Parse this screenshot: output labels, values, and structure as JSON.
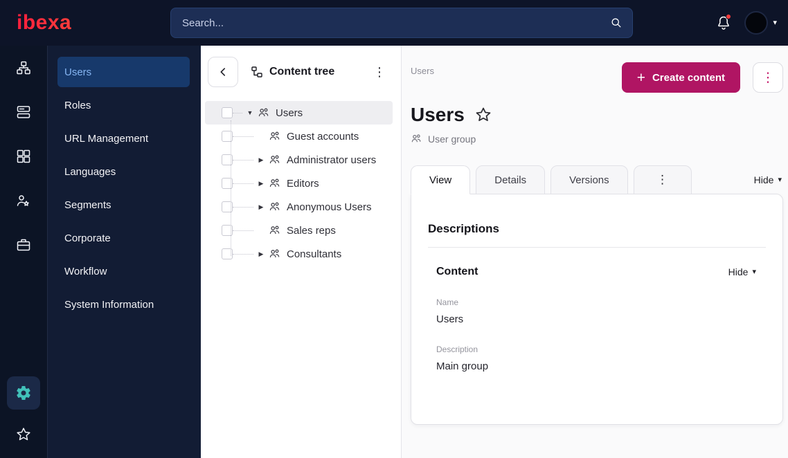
{
  "topbar": {
    "logo_text": "ibexa",
    "search_placeholder": "Search..."
  },
  "rail": {
    "items": [
      "sitemap-icon",
      "content-list-icon",
      "modules-icon",
      "personalization-icon",
      "corporate-icon"
    ],
    "bottom_items": [
      "settings-gear-icon",
      "star-icon"
    ],
    "active_item": "settings-gear-icon"
  },
  "sidebar": {
    "items": [
      "Users",
      "Roles",
      "URL Management",
      "Languages",
      "Segments",
      "Corporate",
      "Workflow",
      "System Information"
    ],
    "active_item": "Users"
  },
  "content_tree": {
    "title": "Content tree",
    "items": [
      {
        "label": "Users",
        "arrow": "▼",
        "level": 0,
        "selected": true
      },
      {
        "label": "Guest accounts",
        "arrow": "",
        "level": 1
      },
      {
        "label": "Administrator users",
        "arrow": "▶",
        "level": 1
      },
      {
        "label": "Editors",
        "arrow": "▶",
        "level": 1
      },
      {
        "label": "Anonymous Users",
        "arrow": "▶",
        "level": 1
      },
      {
        "label": "Sales reps",
        "arrow": "",
        "level": 1
      },
      {
        "label": "Consultants",
        "arrow": "▶",
        "level": 1
      }
    ]
  },
  "main": {
    "breadcrumb": "Users",
    "create_button_label": "Create content",
    "title": "Users",
    "content_type": "User group",
    "tabs": [
      "View",
      "Details",
      "Versions"
    ],
    "active_tab": "View",
    "hide_label": "Hide",
    "card": {
      "heading": "Descriptions",
      "section": {
        "title": "Content",
        "hide_label": "Hide",
        "fields": [
          {
            "label": "Name",
            "value": "Users"
          },
          {
            "label": "Description",
            "value": "Main group"
          }
        ]
      }
    }
  },
  "icons": {
    "kebab": "⋮",
    "caret_down": "▾",
    "plus": "+"
  },
  "colors": {
    "topbar_bg": "#0d1428",
    "sidebar_bg": "#121c34",
    "sidebar_active_bg": "#17396b",
    "sidebar_active_text": "#85b5f2",
    "brand_red": "#ff2743",
    "primary_button": "#b01563",
    "kebab_accent": "#c41768",
    "active_gear_teal": "#41c1ba",
    "notification_dot": "#ff3d3d",
    "tree_selected_bg": "#eeeef1"
  }
}
